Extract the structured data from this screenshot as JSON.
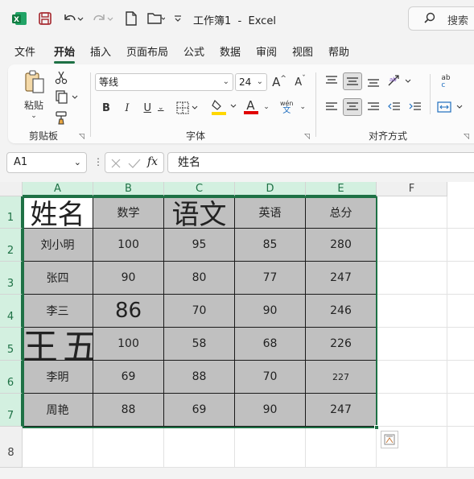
{
  "titlebar": {
    "title": "工作簿1  -  Excel",
    "search_placeholder": "搜索",
    "app_icon": "excel-icon",
    "save_icon": "save-icon",
    "undo_icon": "undo-icon",
    "redo_icon": "redo-icon",
    "new_icon": "new-file-icon",
    "open_icon": "open-folder-icon",
    "customize_icon": "customize-quick-access-icon"
  },
  "menu": {
    "items": [
      "文件",
      "开始",
      "插入",
      "页面布局",
      "公式",
      "数据",
      "审阅",
      "视图",
      "帮助"
    ],
    "active": "开始"
  },
  "ribbon": {
    "clipboard": {
      "paste_label": "粘贴",
      "group_label": "剪贴板"
    },
    "font": {
      "font_name": "等线",
      "font_size": "24",
      "group_label": "字体",
      "bold": "B",
      "italic": "I",
      "underline": "U",
      "grow": "A",
      "shrink": "A",
      "font_color_letter": "A",
      "phonetic_top": "wén",
      "phonetic_bottom": "文"
    },
    "alignment": {
      "group_label": "对齐方式",
      "wrap_top": "ab",
      "wrap_bottom": "c"
    },
    "colors": {
      "highlight": "#ffd700",
      "font_color": "#e00000",
      "accent": "#1e7145"
    }
  },
  "formula_bar": {
    "name_box": "A1",
    "fx_label": "fx",
    "content": "姓名"
  },
  "sheet": {
    "columns": [
      "A",
      "B",
      "C",
      "D",
      "E",
      "F"
    ],
    "rows": [
      "1",
      "2",
      "3",
      "4",
      "5",
      "6",
      "7",
      "8"
    ],
    "cells": [
      [
        "姓名",
        "数学",
        "语文",
        "英语",
        "总分"
      ],
      [
        "刘小明",
        "100",
        "95",
        "85",
        "280"
      ],
      [
        "张四",
        "90",
        "80",
        "77",
        "247"
      ],
      [
        "李三",
        "86",
        "70",
        "90",
        "246"
      ],
      [
        "王五",
        "100",
        "58",
        "68",
        "226"
      ],
      [
        "李明",
        "69",
        "88",
        "70",
        "227"
      ],
      [
        "周艳",
        "88",
        "69",
        "90",
        "247"
      ]
    ],
    "cell_fill": "#c0c0c0",
    "header_cell_fill": "#ffffff"
  }
}
